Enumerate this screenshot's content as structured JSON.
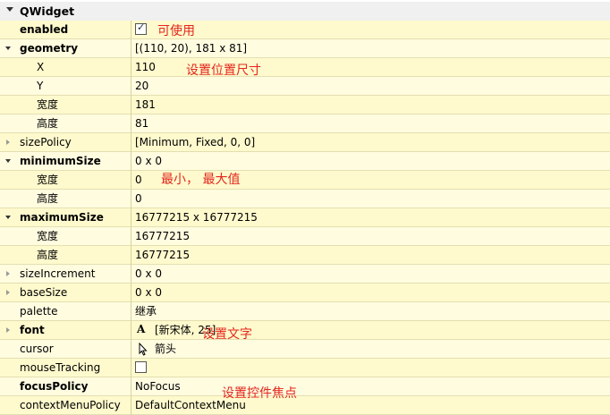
{
  "header": {
    "title": "QWidget"
  },
  "rows": [
    {
      "name": "enabled",
      "value": "",
      "bold": true
    },
    {
      "name": "geometry",
      "value": "[(110, 20), 181 x 81]",
      "bold": true
    },
    {
      "name": "X",
      "value": "110"
    },
    {
      "name": "Y",
      "value": "20"
    },
    {
      "name": "宽度",
      "value": "181"
    },
    {
      "name": "高度",
      "value": "81"
    },
    {
      "name": "sizePolicy",
      "value": "[Minimum, Fixed, 0, 0]"
    },
    {
      "name": "minimumSize",
      "value": "0 x 0",
      "bold": true
    },
    {
      "name": "宽度",
      "value": "0"
    },
    {
      "name": "高度",
      "value": "0"
    },
    {
      "name": "maximumSize",
      "value": "16777215 x 16777215",
      "bold": true
    },
    {
      "name": "宽度",
      "value": "16777215"
    },
    {
      "name": "高度",
      "value": "16777215"
    },
    {
      "name": "sizeIncrement",
      "value": "0 x 0"
    },
    {
      "name": "baseSize",
      "value": "0 x 0"
    },
    {
      "name": "palette",
      "value": "继承"
    },
    {
      "name": "font",
      "value": "[新宋体, 25]",
      "bold": true,
      "icon": "A"
    },
    {
      "name": "cursor",
      "value": "箭头",
      "icon": "arrow-cursor-icon"
    },
    {
      "name": "mouseTracking",
      "value": ""
    },
    {
      "name": "focusPolicy",
      "value": "NoFocus",
      "bold": true
    },
    {
      "name": "contextMenuPolicy",
      "value": "DefaultContextMenu"
    }
  ],
  "state": {
    "enabled_checked": true,
    "mouseTracking_checked": false
  },
  "annotations": {
    "enabled": "可使用",
    "geometry": "设置位置尺寸",
    "minmax": "最小， 最大值",
    "font": "设置文字",
    "focus": "设置控件焦点"
  },
  "colors": {
    "row_bg": "#fffacd",
    "annotation": "#e3261c"
  }
}
